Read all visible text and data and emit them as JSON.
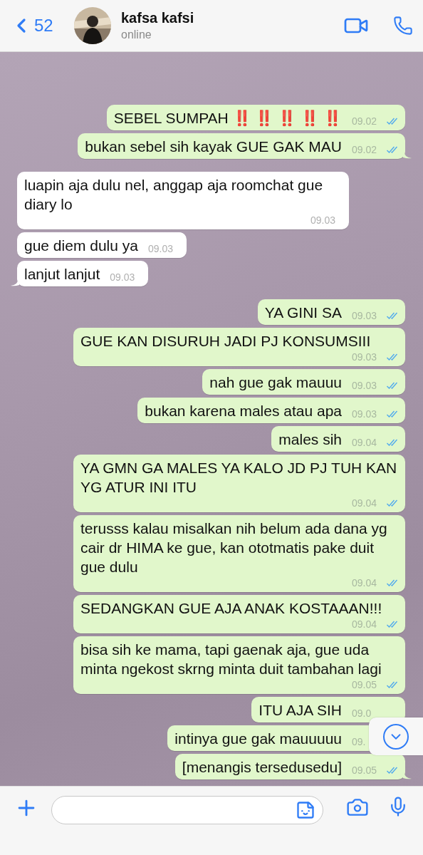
{
  "header": {
    "back_count": "52",
    "name": "kafsa kafsi",
    "status": "online"
  },
  "messages": [
    {
      "kind": "sent",
      "text": "SEBEL SUMPAH ‼️ ‼️ ‼️ ‼️ ‼️",
      "time": "09.02",
      "read": true
    },
    {
      "kind": "sent",
      "text": "bukan sebel sih kayak GUE GAK MAU",
      "time": "09.02",
      "read": true
    },
    {
      "kind": "received",
      "text": "luapin aja dulu nel, anggap aja roomchat gue diary lo",
      "time": "09.03"
    },
    {
      "kind": "received",
      "text": "gue diem dulu ya",
      "time": "09.03"
    },
    {
      "kind": "received",
      "text": "lanjut lanjut",
      "time": "09.03"
    },
    {
      "kind": "sent",
      "text": "YA GINI SA",
      "time": "09.03",
      "read": true
    },
    {
      "kind": "sent",
      "text": "GUE KAN DISURUH JADI PJ KONSUMSIII",
      "time": "09.03",
      "read": true
    },
    {
      "kind": "sent",
      "text": "nah gue gak mauuu",
      "time": "09.03",
      "read": true
    },
    {
      "kind": "sent",
      "text": "bukan karena males atau apa",
      "time": "09.03",
      "read": true
    },
    {
      "kind": "sent",
      "text": "males sih",
      "time": "09.04",
      "read": true
    },
    {
      "kind": "sent",
      "text": "YA GMN GA MALES YA KALO JD PJ TUH KAN YG ATUR INI ITU",
      "time": "09.04",
      "read": true
    },
    {
      "kind": "sent",
      "text": "terusss kalau misalkan nih belum ada dana yg cair dr HIMA ke gue, kan ototmatis pake duit gue dulu",
      "time": "09.04",
      "read": true
    },
    {
      "kind": "sent",
      "text": "SEDANGKAN GUE AJA ANAK KOSTAAAN!!!",
      "time": "09.04",
      "read": true
    },
    {
      "kind": "sent",
      "text": "bisa sih ke mama, tapi gaenak aja, gue uda minta ngekost skrng minta duit tambahan lagi",
      "time": "09.05",
      "read": true
    },
    {
      "kind": "sent",
      "text": "ITU AJA SIH",
      "time": "09.0"
    },
    {
      "kind": "sent",
      "text": "intinya gue gak mauuuuu",
      "time": "09."
    },
    {
      "kind": "sent",
      "text": "[menangis tersedusedu]",
      "time": "09.05",
      "read": true
    }
  ]
}
